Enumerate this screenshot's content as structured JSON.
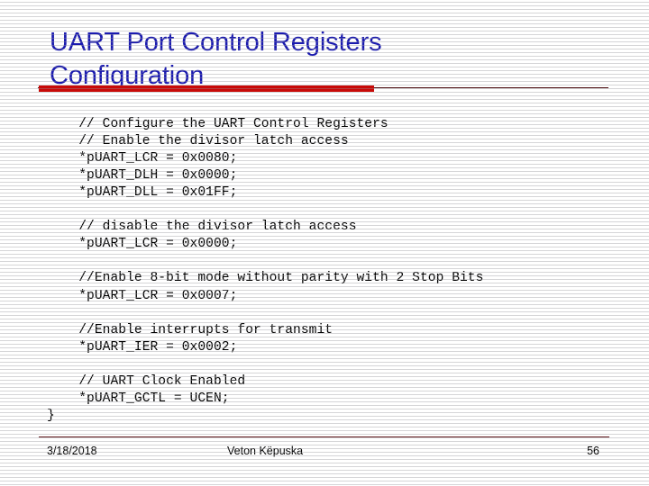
{
  "slide": {
    "title": "UART Port Control Registers\nConfiguration",
    "title_color": "#1A1AAF",
    "accent_bar_color": "#C80A08",
    "rule_color": "#4B0C10",
    "background_color": "#FFFFFF"
  },
  "code": {
    "language": "c",
    "text": "// Configure the UART Control Registers\n// Enable the divisor latch access\n*pUART_LCR = 0x0080;\n*pUART_DLH = 0x0000;\n*pUART_DLL = 0x01FF;\n\n// disable the divisor latch access\n*pUART_LCR = 0x0000;\n\n//Enable 8-bit mode without parity with 2 Stop Bits\n*pUART_LCR = 0x0007;\n\n//Enable interrupts for transmit\n*pUART_IER = 0x0002;\n\n// UART Clock Enabled\n*pUART_GCTL = UCEN;\n}",
    "lines": [
      "    // Configure the UART Control Registers",
      "    // Enable the divisor latch access",
      "    *pUART_LCR = 0x0080;",
      "    *pUART_DLH = 0x0000;",
      "    *pUART_DLL = 0x01FF;",
      "",
      "    // disable the divisor latch access",
      "    *pUART_LCR = 0x0000;",
      "",
      "    //Enable 8-bit mode without parity with 2 Stop Bits",
      "    *pUART_LCR = 0x0007;",
      "",
      "    //Enable interrupts for transmit",
      "    *pUART_IER = 0x0002;",
      "",
      "    // UART Clock Enabled",
      "    *pUART_GCTL = UCEN;",
      "}"
    ]
  },
  "footer": {
    "date": "3/18/2018",
    "author": "Veton Këpuska",
    "page_number": "56"
  }
}
